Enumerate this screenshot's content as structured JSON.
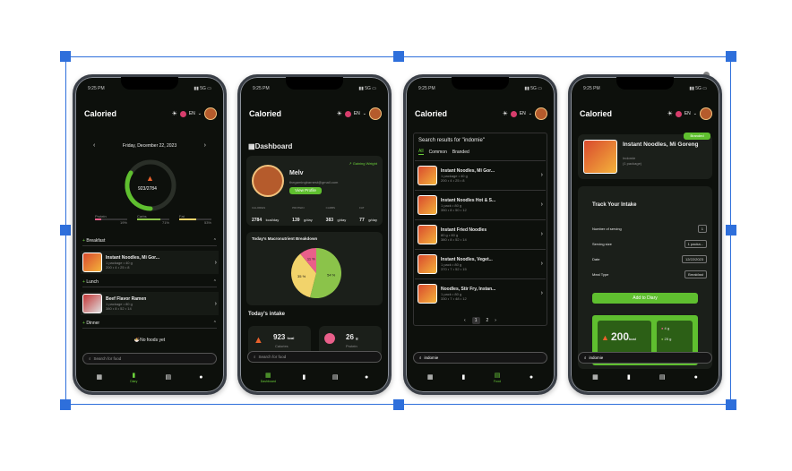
{
  "app": {
    "logo": "Caloried",
    "lang": "EN",
    "status_time": "9:25 PM",
    "status_icons": "▮▮ 5G ▭"
  },
  "nav": {
    "dashboard": "Dashboard",
    "diary": "Diary",
    "food": "Food",
    "search_placeholder": "Search for food"
  },
  "phone1": {
    "date": "Friday, December 22, 2023",
    "kcal": "923/2784",
    "macro_labels": [
      "Protein",
      "Carbs",
      "Fat"
    ],
    "macro_pcts": [
      "19%",
      "71%",
      "53%"
    ],
    "breakfast": "Breakfast",
    "breakfast_item": "Instant Noodles, Mi Gor...",
    "breakfast_sub": "1 package • 40 g",
    "breakfast_vals": "200 • 4 • 25 • 8",
    "lunch": "Lunch",
    "lunch_item": "Beef Flavor Ramen",
    "lunch_sub": "1 package • 80 g",
    "lunch_vals": "380 • 8 • 52 • 14",
    "dinner": "Dinner",
    "no_foods": "No foods yet"
  },
  "phone2": {
    "title": "Dashboard",
    "name": "Melv",
    "email": "thegamingbarnest@gmail.com",
    "badge": "Gaining Weight",
    "view_profile": "View Profile",
    "stat_labels": [
      "CALORIES",
      "PROTEIN",
      "CARBS",
      "FAT"
    ],
    "stat_values": [
      "2784",
      "139",
      "383",
      "77"
    ],
    "stat_units": [
      "kcal/day",
      "g/day",
      "g/day",
      "g/day"
    ],
    "chart_title": "Today's Macronutrient Breakdown",
    "intake_title": "Today's intake",
    "intake_kcal": "923",
    "intake_kcal_unit": "kcal",
    "intake_kcal_label": "Calories",
    "intake_protein": "26",
    "intake_protein_unit": "g",
    "intake_protein_label": "Protein"
  },
  "chart_data": {
    "type": "pie",
    "title": "Today's Macronutrient Breakdown",
    "slices": [
      {
        "name": "Carbs",
        "value": 54,
        "color": "#8bc34a"
      },
      {
        "name": "Fat",
        "value": 35,
        "color": "#f2d36b"
      },
      {
        "name": "Protein",
        "value": 11,
        "color": "#e95f8a"
      }
    ],
    "labels": [
      "54 %",
      "35 %",
      "11 %"
    ]
  },
  "phone3": {
    "heading": "Search results for \"indomie\"",
    "tabs": [
      "All",
      "Common",
      "Branded"
    ],
    "results": [
      {
        "name": "Instant Noodles, Mi Gor...",
        "sub": "1 package • 40 g",
        "vals": "200 • 4 • 25 • 8"
      },
      {
        "name": "Instant Noodles Hot & S...",
        "sub": "1 pack • 80 g",
        "vals": "350 • 8 • 50 • 12"
      },
      {
        "name": "Instant Fried Noodles",
        "sub": "80 g • 80 g",
        "vals": "380 • 8 • 52 • 14"
      },
      {
        "name": "Instant Noodles, Veget...",
        "sub": "1 pack • 80 g",
        "vals": "370 • 7 • 52 • 15"
      },
      {
        "name": "Noodles, Stir Fry, Instan...",
        "sub": "1 pack • 80 g",
        "vals": "330 • 7 • 48 • 12"
      }
    ],
    "pages": [
      "1",
      "2"
    ],
    "search_value": "indomie"
  },
  "phone4": {
    "badge": "Branded",
    "food_name": "Instant Noodles, Mi Goreng",
    "brand": "Indomie",
    "portion": "(1 package)",
    "track_title": "Track Your Intake",
    "form_labels": [
      "Number of serving",
      "Serving size",
      "Date",
      "Meal Type"
    ],
    "form_values": [
      "1",
      "1 packa...",
      "12/22/2023",
      "Breakfast"
    ],
    "add_button": "Add to Diary",
    "kcal": "200",
    "kcal_unit": "kcal",
    "m1": "4 g",
    "m2": "25 g",
    "search_value": "indomie"
  }
}
